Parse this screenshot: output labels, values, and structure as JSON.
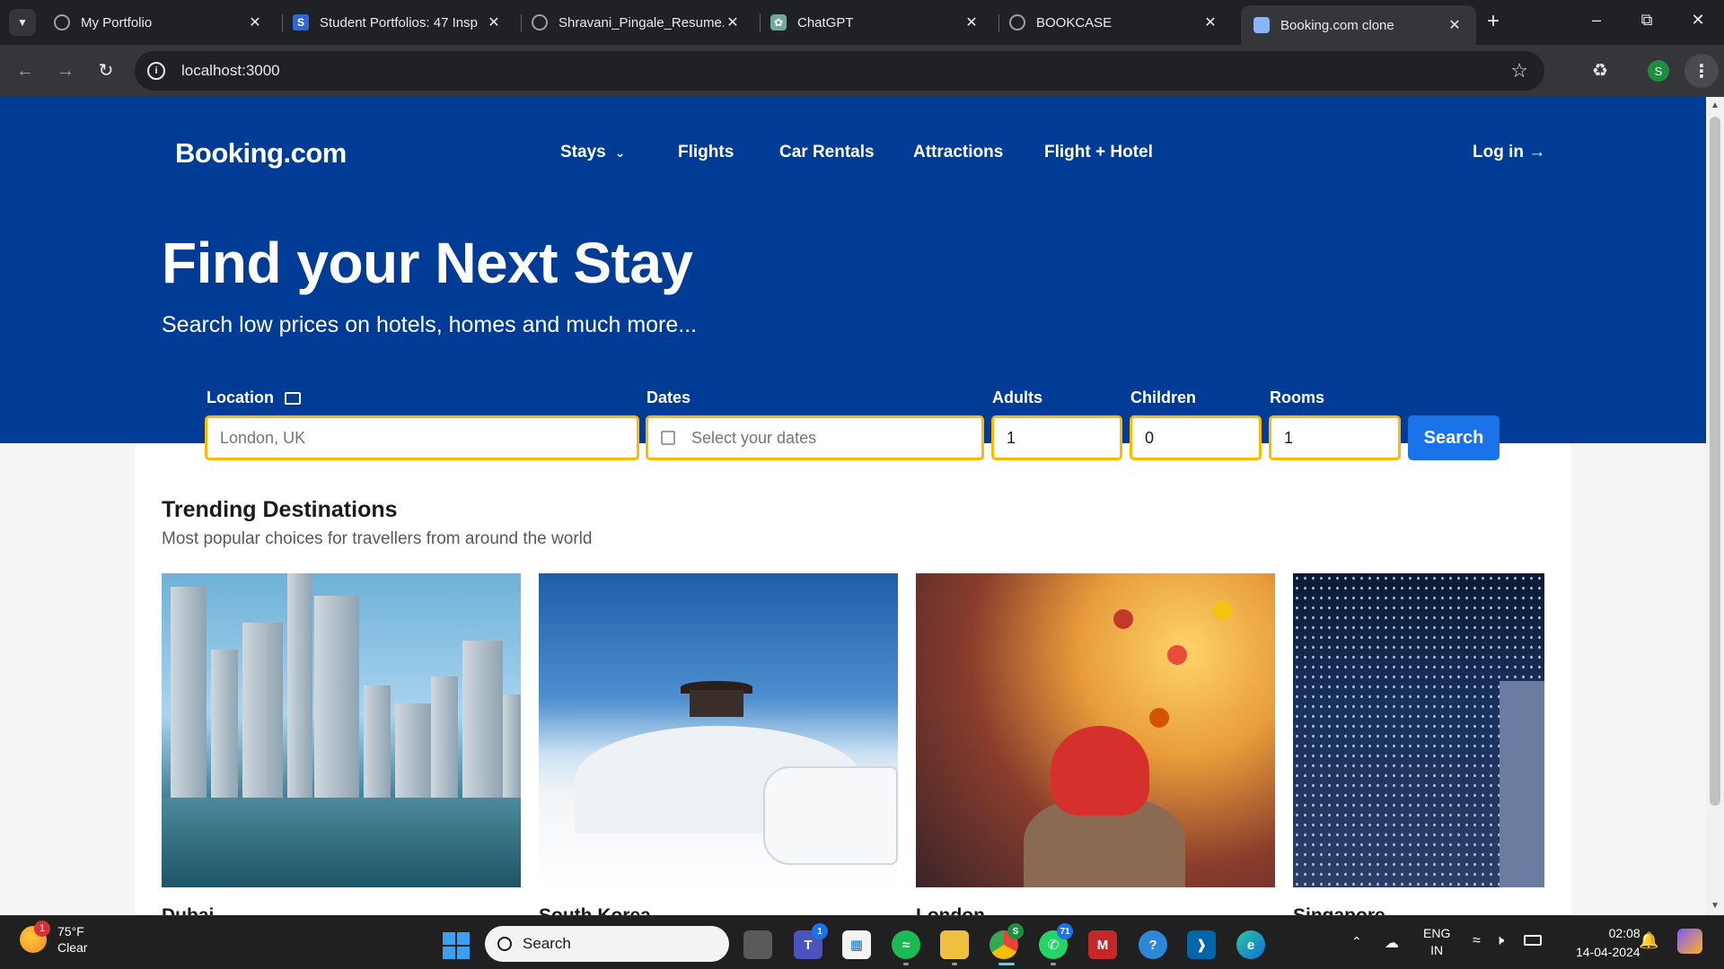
{
  "browser": {
    "tabs": [
      {
        "title": "My Portfolio",
        "icon": "globe-icon"
      },
      {
        "title": "Student Portfolios: 47 Insp",
        "icon": "s-logo-icon"
      },
      {
        "title": "Shravani_Pingale_Resume.p",
        "icon": "globe-icon"
      },
      {
        "title": "ChatGPT",
        "icon": "chatgpt-icon"
      },
      {
        "title": "BOOKCASE",
        "icon": "globe-icon"
      },
      {
        "title": "Booking.com clone",
        "icon": "bus-icon"
      }
    ],
    "active_tab": 5,
    "url": "localhost:3000",
    "profile_initial": "S"
  },
  "page": {
    "logo": "Booking.com",
    "nav": [
      "Stays",
      "Flights",
      "Car Rentals",
      "Attractions",
      "Flight + Hotel"
    ],
    "login": "Log in →",
    "hero_title": "Find your Next Stay",
    "hero_subtitle": "Search low prices on hotels, homes and much more...",
    "search": {
      "location_label": "Location",
      "location_placeholder": "London, UK",
      "dates_label": "Dates",
      "dates_placeholder": "Select your dates",
      "adults_label": "Adults",
      "adults_value": "1",
      "children_label": "Children",
      "children_value": "0",
      "rooms_label": "Rooms",
      "rooms_value": "1",
      "button": "Search"
    },
    "trending": {
      "title": "Trending Destinations",
      "subtitle": "Most popular choices for travellers from around the world",
      "destinations": [
        "Dubai",
        "South Korea",
        "London",
        "Singapore"
      ]
    }
  },
  "taskbar": {
    "weather_temp": "75°F",
    "weather_desc": "Clear",
    "weather_badge": "1",
    "search_label": "Search",
    "teams_badge": "1",
    "chrome_badge": "S",
    "whatsapp_badge": "71",
    "lang": "ENG",
    "region": "IN",
    "time": "02:08",
    "date": "14-04-2024"
  },
  "colors": {
    "brand_blue": "#003b95",
    "accent_yellow": "#ffb700",
    "search_button": "#1a73e8"
  }
}
